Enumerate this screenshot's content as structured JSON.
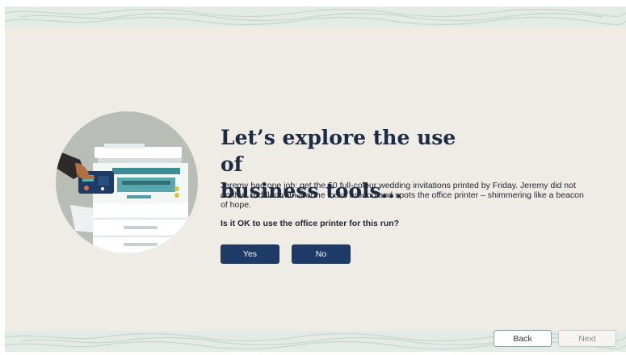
{
  "slide": {
    "title_line1": "Let’s explore the use of",
    "title_line2": "business tools...",
    "body": "Jeremy had one job: get the 50 full-colour wedding invitations printed by Friday. Jeremy did not do this. Riddled with fear he looks around and spots the office printer – shimmering like a beacon of hope.",
    "question": "Is it OK to use the office printer for this run?"
  },
  "answers": {
    "yes_label": "Yes",
    "no_label": "No"
  },
  "navigation": {
    "back_label": "Back",
    "next_label": "Next"
  },
  "icons": {
    "illustration": "office-printer-illustration"
  },
  "colors": {
    "background": "#efece6",
    "pattern_band": "#e3ebe7",
    "title_text": "#1d2c43",
    "primary_button": "#1d3b66",
    "back_border": "#8aa3a6",
    "illustration_circle": "#b9bdb8"
  }
}
